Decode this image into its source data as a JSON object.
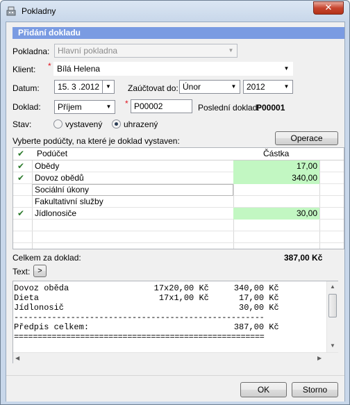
{
  "window": {
    "title": "Pokladny",
    "close_glyph": "✕",
    "app_icon": "cash-register-icon"
  },
  "section": {
    "title": "Přidání dokladu"
  },
  "form": {
    "pokladna_label": "Pokladna:",
    "pokladna_value": "Hlavní pokladna",
    "klient_label": "Klient:",
    "klient_value": "Bílá Helena",
    "datum_label": "Datum:",
    "datum_value": "15. 3 .2012",
    "zauctovat_label": "Zaúčtovat do:",
    "month_value": "Únor",
    "year_value": "2012",
    "doklad_label": "Doklad:",
    "doklad_type": "Příjem",
    "doklad_number": "P00002",
    "posledni_label": "Poslední doklad:",
    "posledni_value": "P00001",
    "stav_label": "Stav:",
    "stav_options": [
      "vystavený",
      "uhrazený"
    ],
    "stav_selected": "uhrazený",
    "required_mark": "*"
  },
  "operace_button": "Operace",
  "grid": {
    "caption": "Vyberte podúčty, na které je doklad vystaven:",
    "header_check": "✔",
    "columns": [
      "Podúčet",
      "Částka"
    ],
    "rows": [
      {
        "checked": true,
        "name": "Obědy",
        "amount": "17,00"
      },
      {
        "checked": true,
        "name": "Dovoz obědů",
        "amount": "340,00"
      },
      {
        "checked": false,
        "name": "Sociální úkony",
        "amount": ""
      },
      {
        "checked": false,
        "name": "Fakultativní služby",
        "amount": ""
      },
      {
        "checked": true,
        "name": "Jídlonosiče",
        "amount": "30,00"
      }
    ],
    "check_glyph": "✔"
  },
  "summary": {
    "label": "Celkem za doklad:",
    "value": "387,00 Kč"
  },
  "text_section": {
    "label": "Text:",
    "expand_glyph": ">"
  },
  "text_lines": [
    "Dovoz oběda                 17x20,00 Kč     340,00 Kč",
    "Dieta                        17x1,00 Kč      17,00 Kč",
    "Jídlonosič                                   30,00 Kč",
    "-----------------------------------------------------",
    "Předpis celkem:                             387,00 Kč",
    "====================================================="
  ],
  "buttons": {
    "ok": "OK",
    "storno": "Storno"
  },
  "colors": {
    "header_bg": "#7a9be2",
    "amount_fill": "#c2f7c2",
    "check": "#2b7a2b",
    "required": "#e0141e"
  }
}
